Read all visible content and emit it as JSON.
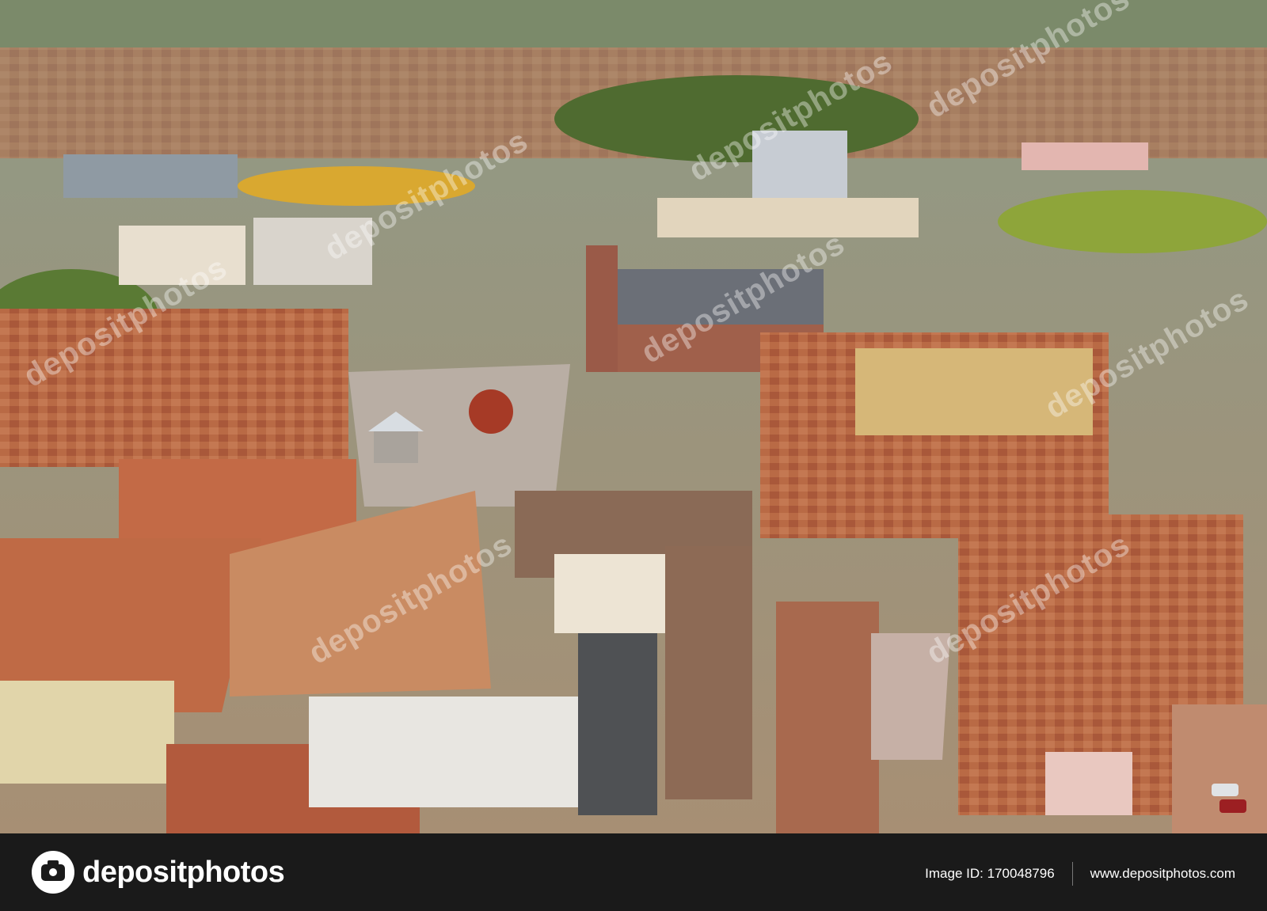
{
  "photo": {
    "subject": "aerial-city-view",
    "watermark_text": "depositphotos",
    "colors": {
      "roof": "#b5603f",
      "roof_dark": "#7d4a36",
      "wall": "#d8c39a",
      "trees": "#5f7a3a",
      "autumn": "#d9a830",
      "square": "#b9aea4"
    }
  },
  "footer": {
    "brand_name": "depositphotos",
    "brand_icon": "camera-icon",
    "image_id": "Image ID: 170048796",
    "site_url": "www.depositphotos.com",
    "background": "#1a1a1a"
  }
}
